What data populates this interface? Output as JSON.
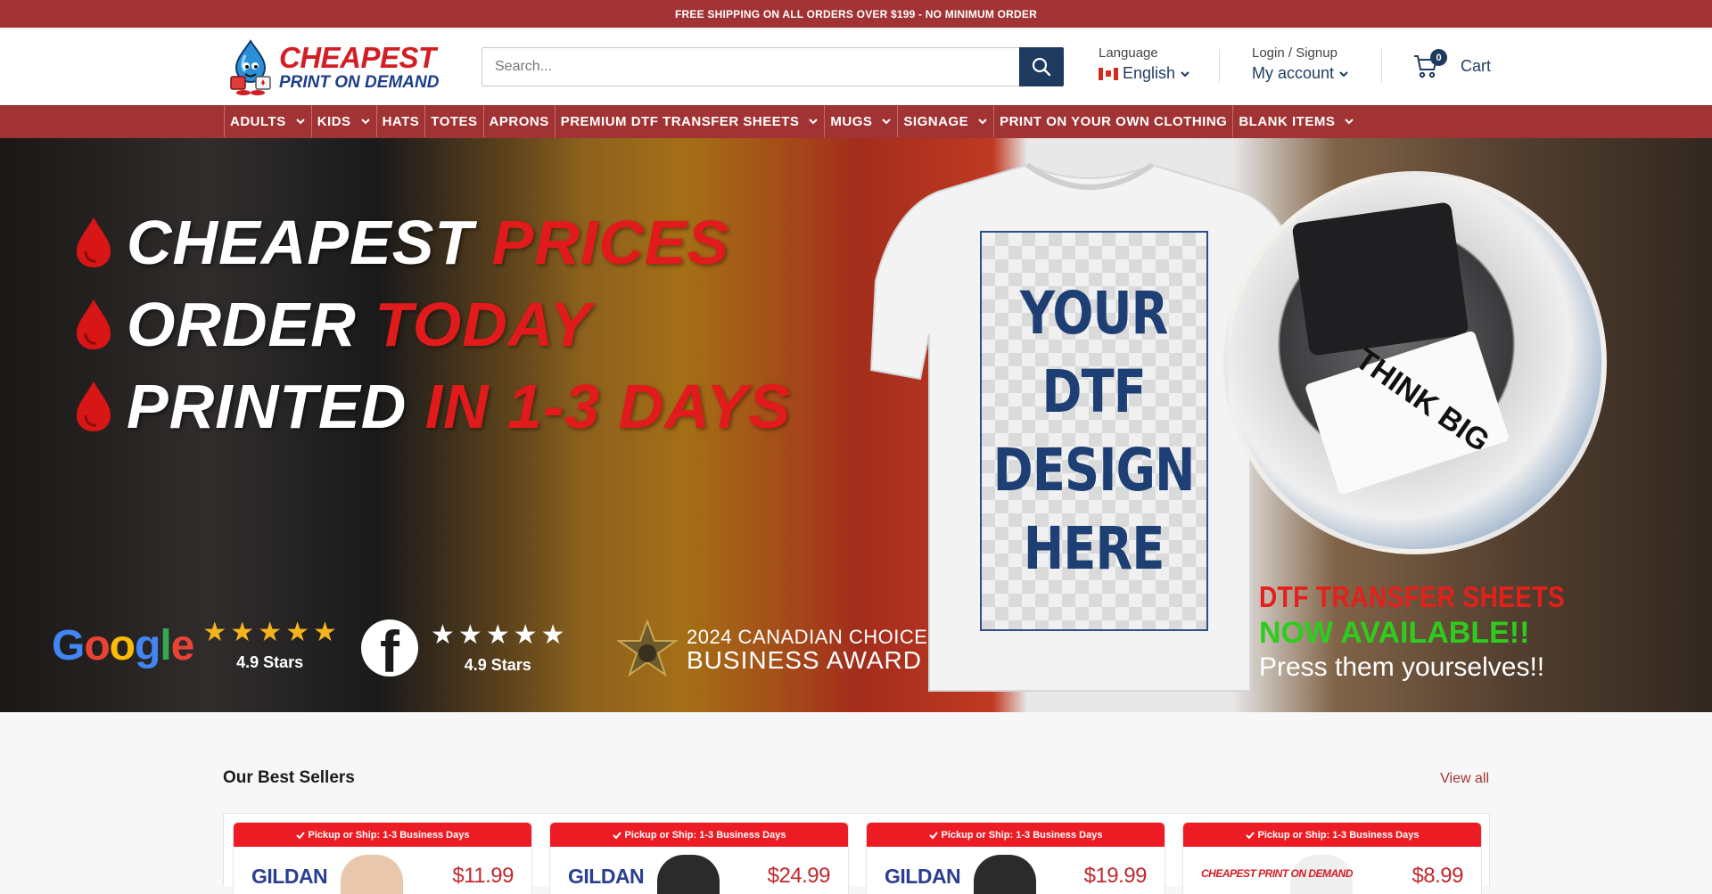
{
  "announcement": "FREE SHIPPING ON ALL ORDERS OVER $199 - NO MINIMUM ORDER",
  "logo": {
    "line1": "CHEAPEST",
    "line2": "PRINT ON DEMAND"
  },
  "search": {
    "placeholder": "Search..."
  },
  "language": {
    "label": "Language",
    "value": "English"
  },
  "account": {
    "label": "Login / Signup",
    "value": "My account"
  },
  "cart": {
    "count": "0",
    "label": "Cart"
  },
  "nav": [
    {
      "label": "ADULTS",
      "has_dropdown": true
    },
    {
      "label": "KIDS",
      "has_dropdown": true
    },
    {
      "label": "HATS",
      "has_dropdown": false
    },
    {
      "label": "TOTES",
      "has_dropdown": false
    },
    {
      "label": "APRONS",
      "has_dropdown": false
    },
    {
      "label": "PREMIUM DTF TRANSFER SHEETS",
      "has_dropdown": true
    },
    {
      "label": "MUGS",
      "has_dropdown": true
    },
    {
      "label": "SIGNAGE",
      "has_dropdown": true
    },
    {
      "label": "PRINT ON YOUR OWN CLOTHING",
      "has_dropdown": false
    },
    {
      "label": "BLANK ITEMS",
      "has_dropdown": true
    }
  ],
  "hero": {
    "lines": [
      {
        "white": "CHEAPEST",
        "red": "PRICES"
      },
      {
        "white": "ORDER",
        "red": "TODAY"
      },
      {
        "white": "PRINTED",
        "red": "IN 1-3 DAYS"
      }
    ],
    "design_text": "YOUR\nDTF\nDESIGN\nHERE",
    "circle_text": "THINK BIG",
    "dtf_line1": "DTF TRANSFER SHEETS",
    "dtf_line2": "NOW AVAILABLE!!",
    "dtf_line3": "Press them yourselves!!",
    "google_word": "Google",
    "google_rating": "4.9 Stars",
    "facebook_rating": "4.9 Stars",
    "award_line1": "2024 CANADIAN CHOICE",
    "award_line2": "BUSINESS AWARD"
  },
  "best_sellers": {
    "title": "Our Best Sellers",
    "view_all": "View all",
    "products": [
      {
        "banner": "Pickup or Ship: 1-3 Business Days",
        "brand": "GILDAN",
        "price": "$11.99"
      },
      {
        "banner": "Pickup or Ship: 1-3 Business Days",
        "brand": "GILDAN",
        "price": "$24.99"
      },
      {
        "banner": "Pickup or Ship: 1-3 Business Days",
        "brand": "GILDAN",
        "price": "$19.99"
      },
      {
        "banner": "Pickup or Ship: 1-3 Business Days",
        "brand": "CHEAPEST PRINT ON DEMAND",
        "price": "$8.99"
      }
    ]
  },
  "colors": {
    "brand_red": "#a23334",
    "navy": "#1e3a5f",
    "accent_red": "#e11b1b",
    "green": "#2ecc1f"
  }
}
